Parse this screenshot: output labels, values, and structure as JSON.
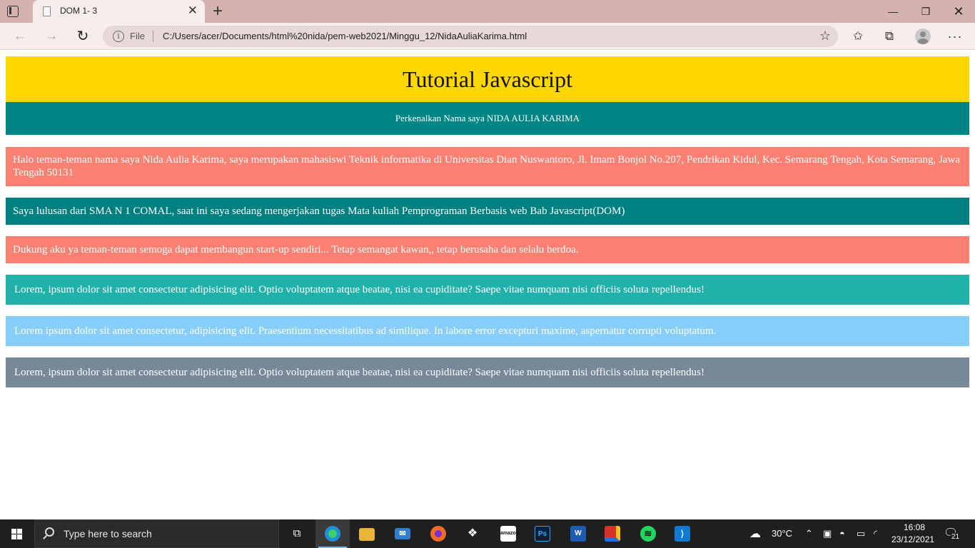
{
  "browser": {
    "tab_title": "DOM 1- 3",
    "url_scheme_label": "File",
    "url": "C:/Users/acer/Documents/html%20nida/pem-web2021/Minggu_12/NidaAuliaKarima.html"
  },
  "page": {
    "title": "Tutorial Javascript",
    "subtitle": "Perkenalkan Nama saya NIDA AULIA KARIMA",
    "paragraphs": [
      {
        "text": "Halo teman-teman nama saya Nida Aulia Karima, saya merupakan mahasiswi Teknik informatika di Universitas Dian Nuswantoro, Jl. Imam Bonjol No.207, Pendrikan Kidul, Kec. Semarang Tengah, Kota Semarang, Jawa Tengah 50131",
        "color": "#fa8072"
      },
      {
        "text": "Saya lulusan dari SMA N 1 COMAL, saat ini saya sedang mengerjakan tugas Mata kuliah Pemprograman Berbasis web Bab Javascript(DOM)",
        "color": "#008080"
      },
      {
        "text": "Dukung aku ya teman-teman semoga dapat membangun start-up sendiri... Tetap semangat kawan,, tetap berusaha dan selalu berdoa.",
        "color": "#fa8072"
      },
      {
        "text": "Lorem, ipsum dolor sit amet consectetur adipisicing elit. Optio voluptatem atque beatae, nisi ea cupiditate? Saepe vitae numquam nisi officiis soluta repellendus!",
        "color": "#20b2aa"
      },
      {
        "text": "Lorem ipsum dolor sit amet consectetur, adipisicing elit. Praesentium necessitatibus ad similique. In labore error excepturi maxime, aspernatur corrupti voluptatum.",
        "color": "#87cefa"
      },
      {
        "text": "Lorem, ipsum dolor sit amet consectetur adipisicing elit. Optio voluptatem atque beatae, nisi ea cupiditate? Saepe vitae numquam nisi officiis soluta repellendus!",
        "color": "#778899"
      }
    ],
    "header_color": "#ffd700",
    "subtitle_color": "#008585"
  },
  "taskbar": {
    "search_placeholder": "Type here to search",
    "weather": "30°C",
    "time": "16:08",
    "date": "23/12/2021",
    "notification_count": "21",
    "apps": [
      "task-view",
      "edge",
      "file-explorer",
      "mail",
      "firefox",
      "dropbox",
      "amazon",
      "photoshop",
      "word",
      "paint",
      "spotify",
      "vscode"
    ]
  }
}
